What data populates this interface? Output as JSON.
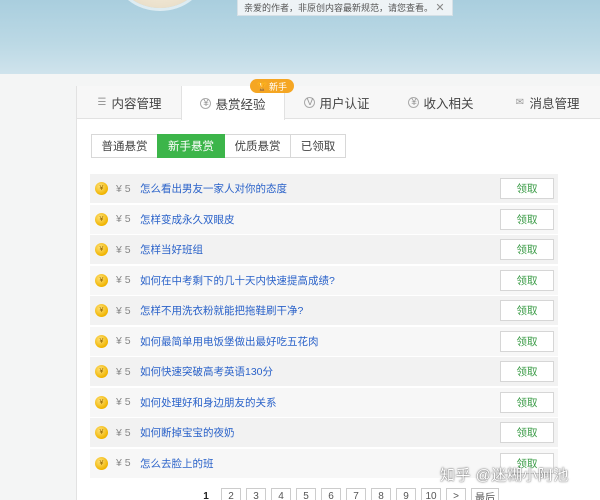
{
  "banner": {
    "notice": "亲爱的作者，非原创内容最新规范，请您查看。",
    "close_icon": "close-icon"
  },
  "badge": {
    "label": "新手",
    "icon": "trophy-icon",
    "color": "#f5a623"
  },
  "tabs": [
    {
      "label": "内容管理",
      "icon": "list-icon"
    },
    {
      "label": "悬赏经验",
      "icon": "coin-icon",
      "active": true
    },
    {
      "label": "用户认证",
      "icon": "v-badge-icon"
    },
    {
      "label": "收入相关",
      "icon": "yen-icon"
    },
    {
      "label": "消息管理",
      "icon": "mail-icon"
    }
  ],
  "subtabs": [
    {
      "label": "普通悬赏"
    },
    {
      "label": "新手悬赏",
      "active": true
    },
    {
      "label": "优质悬赏"
    },
    {
      "label": "已领取"
    }
  ],
  "accent_color": "#3cb54a",
  "claim_label": "领取",
  "rows": [
    {
      "price": "¥ 5",
      "question": "怎么看出男友一家人对你的态度"
    },
    {
      "price": "¥ 5",
      "question": "怎样变成永久双眼皮"
    },
    {
      "price": "¥ 5",
      "question": "怎样当好班组"
    },
    {
      "price": "¥ 5",
      "question": "如何在中考剩下的几十天内快速提高成绩?"
    },
    {
      "price": "¥ 5",
      "question": "怎样不用洗衣粉就能把拖鞋刷干净?"
    },
    {
      "price": "¥ 5",
      "question": "如何最简单用电饭堡做出最好吃五花肉"
    },
    {
      "price": "¥ 5",
      "question": "如何快速突破高考英语130分"
    },
    {
      "price": "¥ 5",
      "question": "如何处理好和身边朋友的关系"
    },
    {
      "price": "¥ 5",
      "question": "如何断掉宝宝的夜奶"
    },
    {
      "price": "¥ 5",
      "question": "怎么去脸上的班"
    }
  ],
  "pagination": {
    "pages": [
      "1",
      "2",
      "3",
      "4",
      "5",
      "6",
      "7",
      "8",
      "9",
      "10"
    ],
    "current": "1",
    "next": ">",
    "last": "最后"
  },
  "watermark": "知乎 @迷糊小阿池"
}
